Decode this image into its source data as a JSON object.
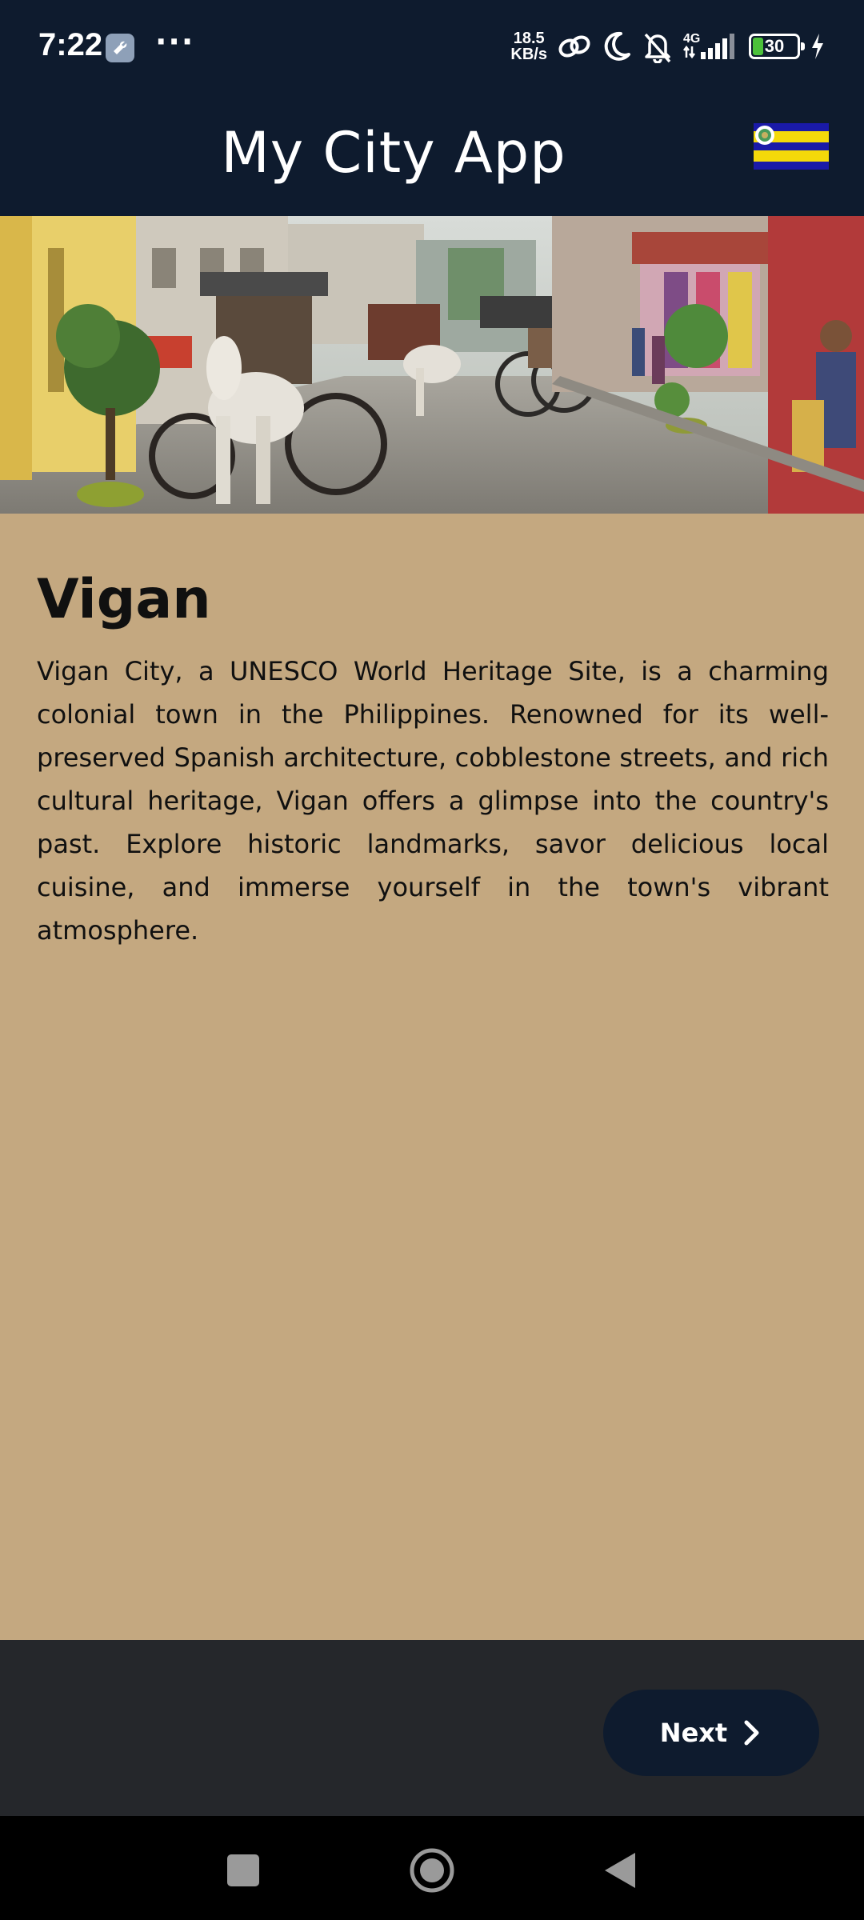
{
  "status_bar": {
    "time": "7:22",
    "dots": "···",
    "net_speed_value": "18.5",
    "net_speed_unit": "KB/s",
    "network_type": "4G",
    "battery_percent": 30,
    "battery_text": "30"
  },
  "app_bar": {
    "title": "My City App",
    "flag_icon": "vigan-flag-icon"
  },
  "city": {
    "name": "Vigan",
    "description": "Vigan City, a UNESCO World Heritage Site, is a charming colonial town in the Philippines. Renowned for its well-preserved Spanish architecture, cobblestone streets, and rich cultural heritage, Vigan offers a glimpse into the country's past. Explore historic landmarks, savor delicious local cuisine, and immerse yourself in the town's vibrant atmosphere."
  },
  "actions": {
    "next_label": "Next",
    "next_icon": "chevron-right-icon"
  },
  "colors": {
    "app_bar": "#0e1b2e",
    "content_background": "#c4a880",
    "bottom_bar": "#25272b",
    "button": "#0e1b2e",
    "battery_fill": "#4cc13a",
    "flag_blue": "#1a1aa8",
    "flag_yellow": "#f4d90a"
  }
}
